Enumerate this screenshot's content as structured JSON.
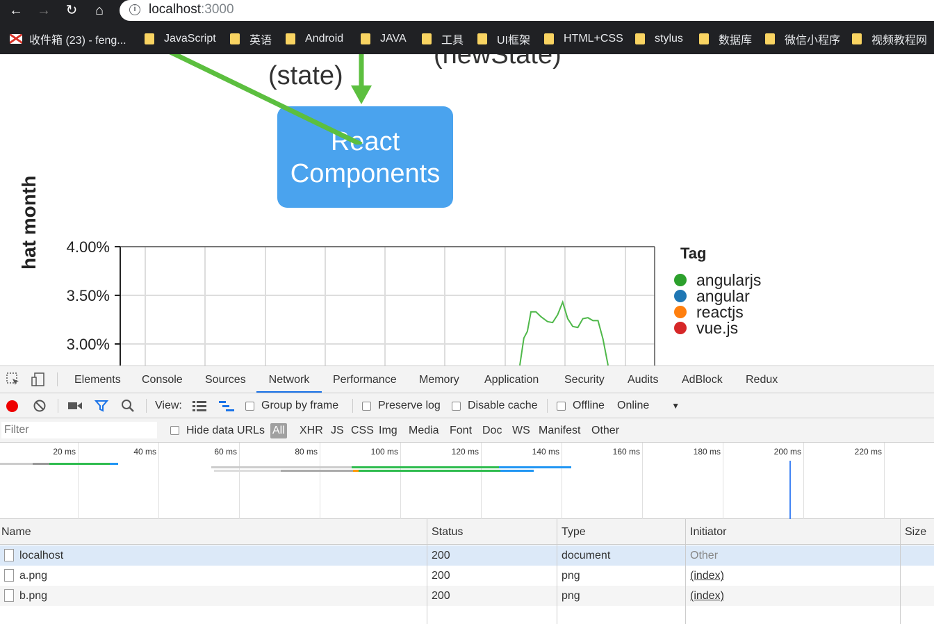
{
  "browser": {
    "url_host": "localhost",
    "url_port": ":3000",
    "bookmarks": [
      {
        "label": "收件箱 (23) - feng...",
        "icon": "gmail-icon"
      },
      {
        "label": "JavaScript",
        "icon": "folder-icon"
      },
      {
        "label": "英语",
        "icon": "folder-icon"
      },
      {
        "label": "Android",
        "icon": "folder-icon"
      },
      {
        "label": "JAVA",
        "icon": "folder-icon"
      },
      {
        "label": "工具",
        "icon": "folder-icon"
      },
      {
        "label": "UI框架",
        "icon": "folder-icon"
      },
      {
        "label": "HTML+CSS",
        "icon": "folder-icon"
      },
      {
        "label": "stylus",
        "icon": "folder-icon"
      },
      {
        "label": "数据库",
        "icon": "folder-icon"
      },
      {
        "label": "微信小程序",
        "icon": "folder-icon"
      },
      {
        "label": "视频教程网",
        "icon": "folder-icon"
      }
    ]
  },
  "page": {
    "diagram": {
      "state_label": "(state)",
      "newstate_label": "(newState)",
      "box_line1": "React",
      "box_line2": "Components"
    },
    "chart": {
      "y_title": "hat month",
      "legend_title": "Tag",
      "legend": [
        {
          "name": "angularjs",
          "color": "#2ca02c"
        },
        {
          "name": "angular",
          "color": "#1f77b4"
        },
        {
          "name": "reactjs",
          "color": "#ff7f0e"
        },
        {
          "name": "vue.js",
          "color": "#d62728"
        }
      ]
    }
  },
  "chart_data": {
    "type": "line",
    "ytick_labels": [
      "4.00%",
      "3.50%",
      "3.00%"
    ],
    "ylim_visible": [
      2.8,
      4.0
    ],
    "series": [
      {
        "name": "angularjs",
        "color": "#2ca02c",
        "points": [
          [
            0.0,
            2.78
          ],
          [
            0.08,
            3.06
          ],
          [
            0.15,
            3.13
          ],
          [
            0.22,
            3.33
          ],
          [
            0.32,
            3.33
          ],
          [
            0.42,
            3.28
          ],
          [
            0.55,
            3.23
          ],
          [
            0.65,
            3.22
          ],
          [
            0.75,
            3.3
          ],
          [
            0.85,
            3.43
          ],
          [
            0.95,
            3.26
          ],
          [
            1.05,
            3.18
          ],
          [
            1.15,
            3.17
          ],
          [
            1.25,
            3.26
          ],
          [
            1.35,
            3.27
          ],
          [
            1.45,
            3.24
          ],
          [
            1.55,
            3.24
          ],
          [
            1.65,
            3.05
          ],
          [
            1.75,
            2.78
          ]
        ]
      }
    ]
  },
  "devtools": {
    "tabs": [
      "Elements",
      "Console",
      "Sources",
      "Network",
      "Performance",
      "Memory",
      "Application",
      "Security",
      "Audits",
      "AdBlock",
      "Redux"
    ],
    "active_tab": "Network",
    "toolbar": {
      "view_label": "View:",
      "group_by_frame": "Group by frame",
      "preserve_log": "Preserve log",
      "disable_cache": "Disable cache",
      "offline": "Offline",
      "throttle": "Online"
    },
    "filter": {
      "placeholder": "Filter",
      "hide_data_urls": "Hide data URLs",
      "types": [
        "All",
        "XHR",
        "JS",
        "CSS",
        "Img",
        "Media",
        "Font",
        "Doc",
        "WS",
        "Manifest",
        "Other"
      ]
    },
    "overview_ticks": [
      "20 ms",
      "40 ms",
      "60 ms",
      "80 ms",
      "100 ms",
      "120 ms",
      "140 ms",
      "160 ms",
      "180 ms",
      "200 ms",
      "220 ms"
    ],
    "table": {
      "columns": [
        "Name",
        "Status",
        "Type",
        "Initiator",
        "Size"
      ],
      "rows": [
        {
          "name": "localhost",
          "status": "200",
          "type": "document",
          "initiator": "Other"
        },
        {
          "name": "a.png",
          "status": "200",
          "type": "png",
          "initiator": "(index)"
        },
        {
          "name": "b.png",
          "status": "200",
          "type": "png",
          "initiator": "(index)"
        }
      ]
    }
  }
}
